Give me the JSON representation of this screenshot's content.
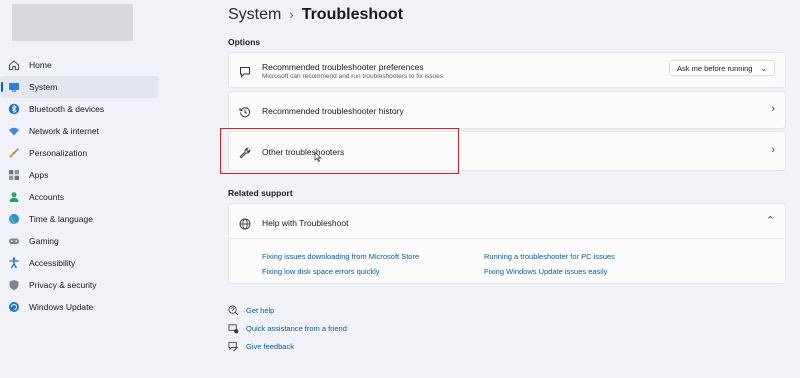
{
  "sidebar": {
    "items": [
      {
        "label": "Home",
        "icon": "home-icon"
      },
      {
        "label": "System",
        "icon": "system-icon",
        "active": true
      },
      {
        "label": "Bluetooth & devices",
        "icon": "bluetooth-icon"
      },
      {
        "label": "Network & internet",
        "icon": "wifi-icon"
      },
      {
        "label": "Personalization",
        "icon": "brush-icon"
      },
      {
        "label": "Apps",
        "icon": "apps-icon"
      },
      {
        "label": "Accounts",
        "icon": "accounts-icon"
      },
      {
        "label": "Time & language",
        "icon": "globe-icon"
      },
      {
        "label": "Gaming",
        "icon": "gaming-icon"
      },
      {
        "label": "Accessibility",
        "icon": "accessibility-icon"
      },
      {
        "label": "Privacy & security",
        "icon": "shield-icon"
      },
      {
        "label": "Windows Update",
        "icon": "update-icon"
      }
    ]
  },
  "breadcrumb": {
    "parent": "System",
    "separator": "›",
    "current": "Troubleshoot"
  },
  "options": {
    "heading": "Options",
    "preferences": {
      "title": "Recommended troubleshooter preferences",
      "subtitle": "Microsoft can recommend and run troubleshooters to fix issues",
      "dropdown_value": "Ask me before running"
    },
    "history": {
      "title": "Recommended troubleshooter history"
    },
    "other": {
      "title": "Other troubleshooters"
    }
  },
  "related": {
    "heading": "Related support",
    "help": {
      "title": "Help with Troubleshoot",
      "links": [
        "Fixing issues downloading from Microsoft Store",
        "Running a troubleshooter for PC issues",
        "Fixing low disk space errors quickly",
        "Fixing Windows Update issues easily"
      ]
    }
  },
  "footer": {
    "get_help": "Get help",
    "quick_assist": "Quick assistance from a friend",
    "feedback": "Give feedback"
  },
  "colors": {
    "accent": "#0067c0",
    "link": "#0b5cad",
    "highlight": "#d8202a"
  }
}
